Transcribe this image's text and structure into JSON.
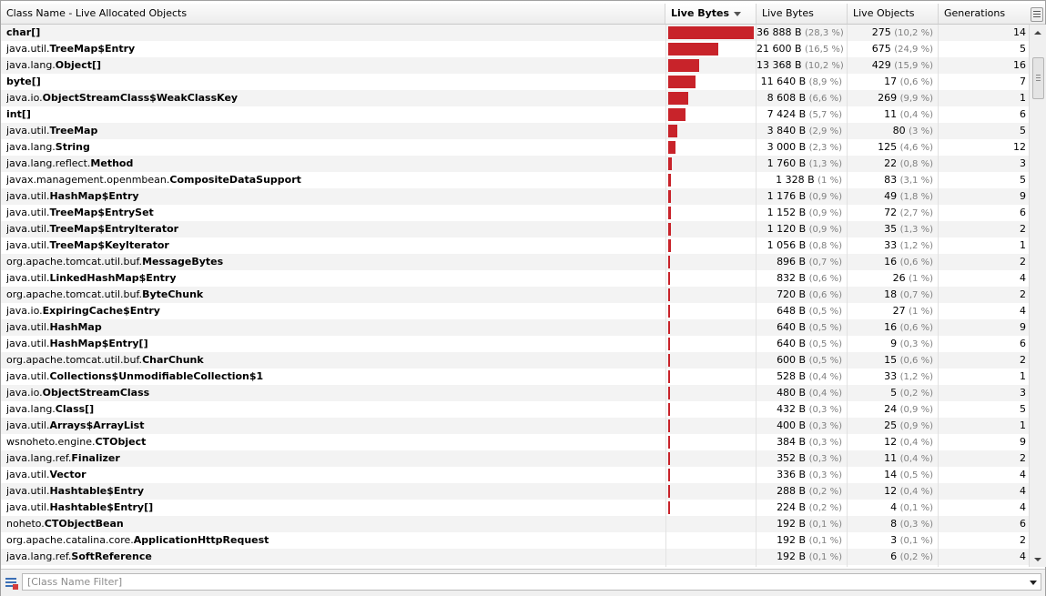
{
  "header": {
    "col_name": "Class Name - Live Allocated Objects",
    "col_bar": "Live Bytes",
    "col_bytes": "Live Bytes",
    "col_objects": "Live Objects",
    "col_gen": "Generations"
  },
  "filter": {
    "placeholder": "[Class Name Filter]"
  },
  "colors": {
    "bar": "#c8232a",
    "percent": "#808080"
  },
  "rows": [
    {
      "pkg": "",
      "cls": "char[]",
      "bytes": "36 888 B",
      "bytes_pct": "(28,3 %)",
      "objs": "275",
      "objs_pct": "(10,2 %)",
      "gen": "14",
      "bar": 28.3
    },
    {
      "pkg": "java.util.",
      "cls": "TreeMap$Entry",
      "bytes": "21 600 B",
      "bytes_pct": "(16,5 %)",
      "objs": "675",
      "objs_pct": "(24,9 %)",
      "gen": "5",
      "bar": 16.5
    },
    {
      "pkg": "java.lang.",
      "cls": "Object[]",
      "bytes": "13 368 B",
      "bytes_pct": "(10,2 %)",
      "objs": "429",
      "objs_pct": "(15,9 %)",
      "gen": "16",
      "bar": 10.2
    },
    {
      "pkg": "",
      "cls": "byte[]",
      "bytes": "11 640 B",
      "bytes_pct": "(8,9 %)",
      "objs": "17",
      "objs_pct": "(0,6 %)",
      "gen": "7",
      "bar": 8.9
    },
    {
      "pkg": "java.io.",
      "cls": "ObjectStreamClass$WeakClassKey",
      "bytes": "8 608 B",
      "bytes_pct": "(6,6 %)",
      "objs": "269",
      "objs_pct": "(9,9 %)",
      "gen": "1",
      "bar": 6.6
    },
    {
      "pkg": "",
      "cls": "int[]",
      "bytes": "7 424 B",
      "bytes_pct": "(5,7 %)",
      "objs": "11",
      "objs_pct": "(0,4 %)",
      "gen": "6",
      "bar": 5.7
    },
    {
      "pkg": "java.util.",
      "cls": "TreeMap",
      "bytes": "3 840 B",
      "bytes_pct": "(2,9 %)",
      "objs": "80",
      "objs_pct": "(3 %)",
      "gen": "5",
      "bar": 2.9
    },
    {
      "pkg": "java.lang.",
      "cls": "String",
      "bytes": "3 000 B",
      "bytes_pct": "(2,3 %)",
      "objs": "125",
      "objs_pct": "(4,6 %)",
      "gen": "12",
      "bar": 2.3
    },
    {
      "pkg": "java.lang.reflect.",
      "cls": "Method",
      "bytes": "1 760 B",
      "bytes_pct": "(1,3 %)",
      "objs": "22",
      "objs_pct": "(0,8 %)",
      "gen": "3",
      "bar": 1.3
    },
    {
      "pkg": "javax.management.openmbean.",
      "cls": "CompositeDataSupport",
      "bytes": "1 328 B",
      "bytes_pct": "(1 %)",
      "objs": "83",
      "objs_pct": "(3,1 %)",
      "gen": "5",
      "bar": 1.0
    },
    {
      "pkg": "java.util.",
      "cls": "HashMap$Entry",
      "bytes": "1 176 B",
      "bytes_pct": "(0,9 %)",
      "objs": "49",
      "objs_pct": "(1,8 %)",
      "gen": "9",
      "bar": 0.9
    },
    {
      "pkg": "java.util.",
      "cls": "TreeMap$EntrySet",
      "bytes": "1 152 B",
      "bytes_pct": "(0,9 %)",
      "objs": "72",
      "objs_pct": "(2,7 %)",
      "gen": "6",
      "bar": 0.9
    },
    {
      "pkg": "java.util.",
      "cls": "TreeMap$EntryIterator",
      "bytes": "1 120 B",
      "bytes_pct": "(0,9 %)",
      "objs": "35",
      "objs_pct": "(1,3 %)",
      "gen": "2",
      "bar": 0.9
    },
    {
      "pkg": "java.util.",
      "cls": "TreeMap$KeyIterator",
      "bytes": "1 056 B",
      "bytes_pct": "(0,8 %)",
      "objs": "33",
      "objs_pct": "(1,2 %)",
      "gen": "1",
      "bar": 0.8
    },
    {
      "pkg": "org.apache.tomcat.util.buf.",
      "cls": "MessageBytes",
      "bytes": "896 B",
      "bytes_pct": "(0,7 %)",
      "objs": "16",
      "objs_pct": "(0,6 %)",
      "gen": "2",
      "bar": 0.7
    },
    {
      "pkg": "java.util.",
      "cls": "LinkedHashMap$Entry",
      "bytes": "832 B",
      "bytes_pct": "(0,6 %)",
      "objs": "26",
      "objs_pct": "(1 %)",
      "gen": "4",
      "bar": 0.6
    },
    {
      "pkg": "org.apache.tomcat.util.buf.",
      "cls": "ByteChunk",
      "bytes": "720 B",
      "bytes_pct": "(0,6 %)",
      "objs": "18",
      "objs_pct": "(0,7 %)",
      "gen": "2",
      "bar": 0.6
    },
    {
      "pkg": "java.io.",
      "cls": "ExpiringCache$Entry",
      "bytes": "648 B",
      "bytes_pct": "(0,5 %)",
      "objs": "27",
      "objs_pct": "(1 %)",
      "gen": "4",
      "bar": 0.5
    },
    {
      "pkg": "java.util.",
      "cls": "HashMap",
      "bytes": "640 B",
      "bytes_pct": "(0,5 %)",
      "objs": "16",
      "objs_pct": "(0,6 %)",
      "gen": "9",
      "bar": 0.5
    },
    {
      "pkg": "java.util.",
      "cls": "HashMap$Entry[]",
      "bytes": "640 B",
      "bytes_pct": "(0,5 %)",
      "objs": "9",
      "objs_pct": "(0,3 %)",
      "gen": "6",
      "bar": 0.5
    },
    {
      "pkg": "org.apache.tomcat.util.buf.",
      "cls": "CharChunk",
      "bytes": "600 B",
      "bytes_pct": "(0,5 %)",
      "objs": "15",
      "objs_pct": "(0,6 %)",
      "gen": "2",
      "bar": 0.5
    },
    {
      "pkg": "java.util.",
      "cls": "Collections$UnmodifiableCollection$1",
      "bytes": "528 B",
      "bytes_pct": "(0,4 %)",
      "objs": "33",
      "objs_pct": "(1,2 %)",
      "gen": "1",
      "bar": 0.4
    },
    {
      "pkg": "java.io.",
      "cls": "ObjectStreamClass",
      "bytes": "480 B",
      "bytes_pct": "(0,4 %)",
      "objs": "5",
      "objs_pct": "(0,2 %)",
      "gen": "3",
      "bar": 0.4
    },
    {
      "pkg": "java.lang.",
      "cls": "Class[]",
      "bytes": "432 B",
      "bytes_pct": "(0,3 %)",
      "objs": "24",
      "objs_pct": "(0,9 %)",
      "gen": "5",
      "bar": 0.3
    },
    {
      "pkg": "java.util.",
      "cls": "Arrays$ArrayList",
      "bytes": "400 B",
      "bytes_pct": "(0,3 %)",
      "objs": "25",
      "objs_pct": "(0,9 %)",
      "gen": "1",
      "bar": 0.3
    },
    {
      "pkg": "wsnoheto.engine.",
      "cls": "CTObject",
      "bytes": "384 B",
      "bytes_pct": "(0,3 %)",
      "objs": "12",
      "objs_pct": "(0,4 %)",
      "gen": "9",
      "bar": 0.3
    },
    {
      "pkg": "java.lang.ref.",
      "cls": "Finalizer",
      "bytes": "352 B",
      "bytes_pct": "(0,3 %)",
      "objs": "11",
      "objs_pct": "(0,4 %)",
      "gen": "2",
      "bar": 0.3
    },
    {
      "pkg": "java.util.",
      "cls": "Vector",
      "bytes": "336 B",
      "bytes_pct": "(0,3 %)",
      "objs": "14",
      "objs_pct": "(0,5 %)",
      "gen": "4",
      "bar": 0.3
    },
    {
      "pkg": "java.util.",
      "cls": "Hashtable$Entry",
      "bytes": "288 B",
      "bytes_pct": "(0,2 %)",
      "objs": "12",
      "objs_pct": "(0,4 %)",
      "gen": "4",
      "bar": 0.2
    },
    {
      "pkg": "java.util.",
      "cls": "Hashtable$Entry[]",
      "bytes": "224 B",
      "bytes_pct": "(0,2 %)",
      "objs": "4",
      "objs_pct": "(0,1 %)",
      "gen": "4",
      "bar": 0.2
    },
    {
      "pkg": "noheto.",
      "cls": "CTObjectBean",
      "bytes": "192 B",
      "bytes_pct": "(0,1 %)",
      "objs": "8",
      "objs_pct": "(0,3 %)",
      "gen": "6",
      "bar": 0.0
    },
    {
      "pkg": "org.apache.catalina.core.",
      "cls": "ApplicationHttpRequest",
      "bytes": "192 B",
      "bytes_pct": "(0,1 %)",
      "objs": "3",
      "objs_pct": "(0,1 %)",
      "gen": "2",
      "bar": 0.0
    },
    {
      "pkg": "java.lang.ref.",
      "cls": "SoftReference",
      "bytes": "192 B",
      "bytes_pct": "(0,1 %)",
      "objs": "6",
      "objs_pct": "(0,2 %)",
      "gen": "4",
      "bar": 0.0
    },
    {
      "pkg": "",
      "cls": "",
      "bytes": "",
      "bytes_pct": "",
      "objs": "",
      "objs_pct": "",
      "gen": "",
      "bar": 0.0
    }
  ]
}
